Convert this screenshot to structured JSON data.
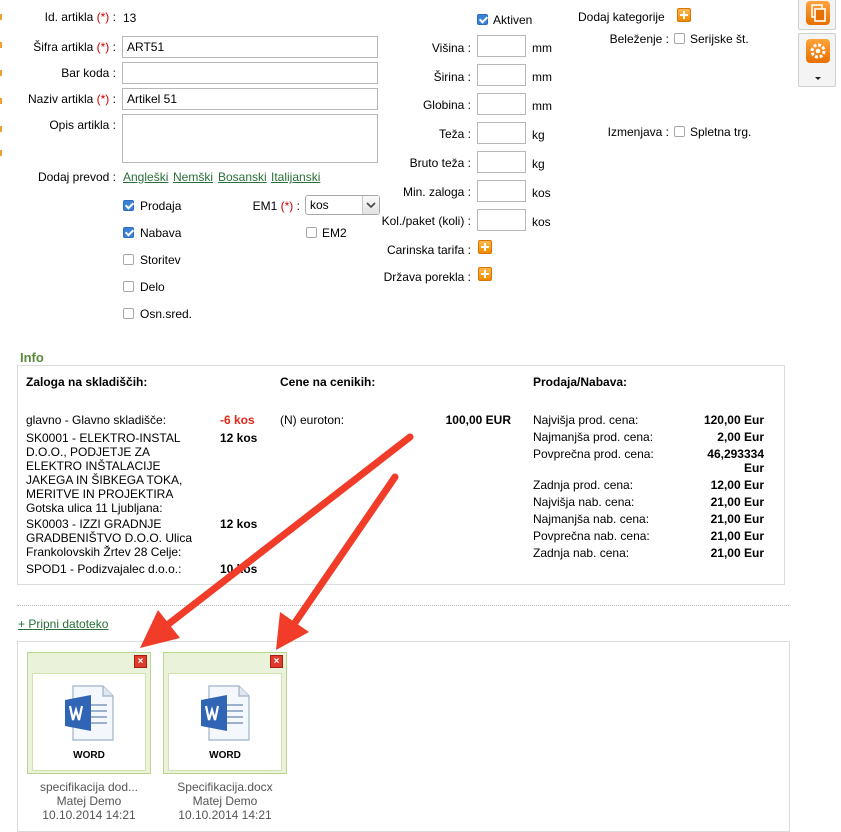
{
  "form": {
    "id_label": "Id. artikla",
    "id_value": "13",
    "req_mark": "(*)",
    "sifra_label": "Šifra artikla",
    "sifra_value": "ART51",
    "barkoda_label": "Bar koda :",
    "barkoda_value": "",
    "naziv_label": "Naziv artikla",
    "naziv_value": "Artikel 51",
    "opis_label": "Opis artikla :",
    "opis_value": "",
    "colon": ":",
    "prevod_label": "Dodaj prevod :",
    "prevod_links": [
      "Angleški",
      "Nemški",
      "Bosanski",
      "Italijanski"
    ],
    "type_checks": [
      {
        "label": "Prodaja",
        "checked": true
      },
      {
        "label": "Nabava",
        "checked": true
      },
      {
        "label": "Storitev",
        "checked": false
      },
      {
        "label": "Delo",
        "checked": false
      },
      {
        "label": "Osn.sred.",
        "checked": false
      }
    ],
    "em1_label": "EM1",
    "em1_value": "kos",
    "em2_label": "EM2",
    "em2_checked": false
  },
  "mid": {
    "aktiven_label": "Aktiven",
    "aktiven_checked": true,
    "fields": [
      {
        "label": "Višina :",
        "unit": "mm"
      },
      {
        "label": "Širina :",
        "unit": "mm"
      },
      {
        "label": "Globina :",
        "unit": "mm"
      },
      {
        "label": "Teža :",
        "unit": "kg"
      },
      {
        "label": "Bruto teža :",
        "unit": "kg"
      },
      {
        "label": "Min. zaloga :",
        "unit": "kos"
      },
      {
        "label": "Kol./paket (koli) :",
        "unit": "kos"
      }
    ],
    "carinska_label": "Carinska tarifa :",
    "drzava_label": "Država porekla :"
  },
  "right": {
    "kategorije_label": "Dodaj kategorije",
    "belezenje_label": "Beleženje :",
    "serijske_label": "Serijske št.",
    "izmenjava_label": "Izmenjava :",
    "spletna_label": "Spletna trg."
  },
  "info": {
    "title": "Info",
    "zaloga_header": "Zaloga na skladiščih:",
    "cene_header": "Cene na cenikih:",
    "prodaja_header": "Prodaja/Nabava:",
    "stock": [
      {
        "name": "glavno - Glavno skladišče:",
        "qty": "-6 kos",
        "negative": true
      },
      {
        "name": "SK0001 - ELEKTRO-INSTAL D.O.O., PODJETJE ZA ELEKTRO INŠTALACIJE JAKEGA IN ŠIBKEGA TOKA, MERITVE IN PROJEKTIRA Gotska ulica 11 Ljubljana:",
        "qty": "12 kos",
        "negative": false
      },
      {
        "name": "SK0003 - IZZI GRADNJE GRADBENIŠTVO D.O.O. Ulica Frankolovskih Žrtev 28 Celje:",
        "qty": "12 kos",
        "negative": false
      },
      {
        "name": "SPOD1 - Podizvajalec d.o.o.:",
        "qty": "10 kos",
        "negative": false
      }
    ],
    "cenik_name": "(N) euroton:",
    "cenik_value": "100,00 EUR",
    "prices": [
      {
        "label": "Najvišja prod. cena:",
        "value": "120,00 Eur"
      },
      {
        "label": "Najmanjša prod. cena:",
        "value": "2,00 Eur"
      },
      {
        "label": "Povprečna prod. cena:",
        "value": "46,293334 Eur"
      },
      {
        "label": "Zadnja prod. cena:",
        "value": "12,00 Eur"
      },
      {
        "label": "Najvišja nab. cena:",
        "value": "21,00 Eur"
      },
      {
        "label": "Najmanjša nab. cena:",
        "value": "21,00 Eur"
      },
      {
        "label": "Povprečna nab. cena:",
        "value": "21,00 Eur"
      },
      {
        "label": "Zadnja nab. cena:",
        "value": "21,00 Eur"
      }
    ]
  },
  "files": {
    "attach_label": "+ Pripni datoteko",
    "items": [
      {
        "type": "WORD",
        "name": "specifikacija dod...",
        "user": "Matej Demo",
        "date": "10.10.2014 14:21"
      },
      {
        "type": "WORD",
        "name": "Specifikacija.docx",
        "user": "Matej Demo",
        "date": "10.10.2014 14:21"
      }
    ]
  },
  "colors": {
    "accent_green": "#2a6e3a",
    "required_red": "#cc0000",
    "orange": "#f08a00",
    "arrow_red": "#f03c28"
  }
}
